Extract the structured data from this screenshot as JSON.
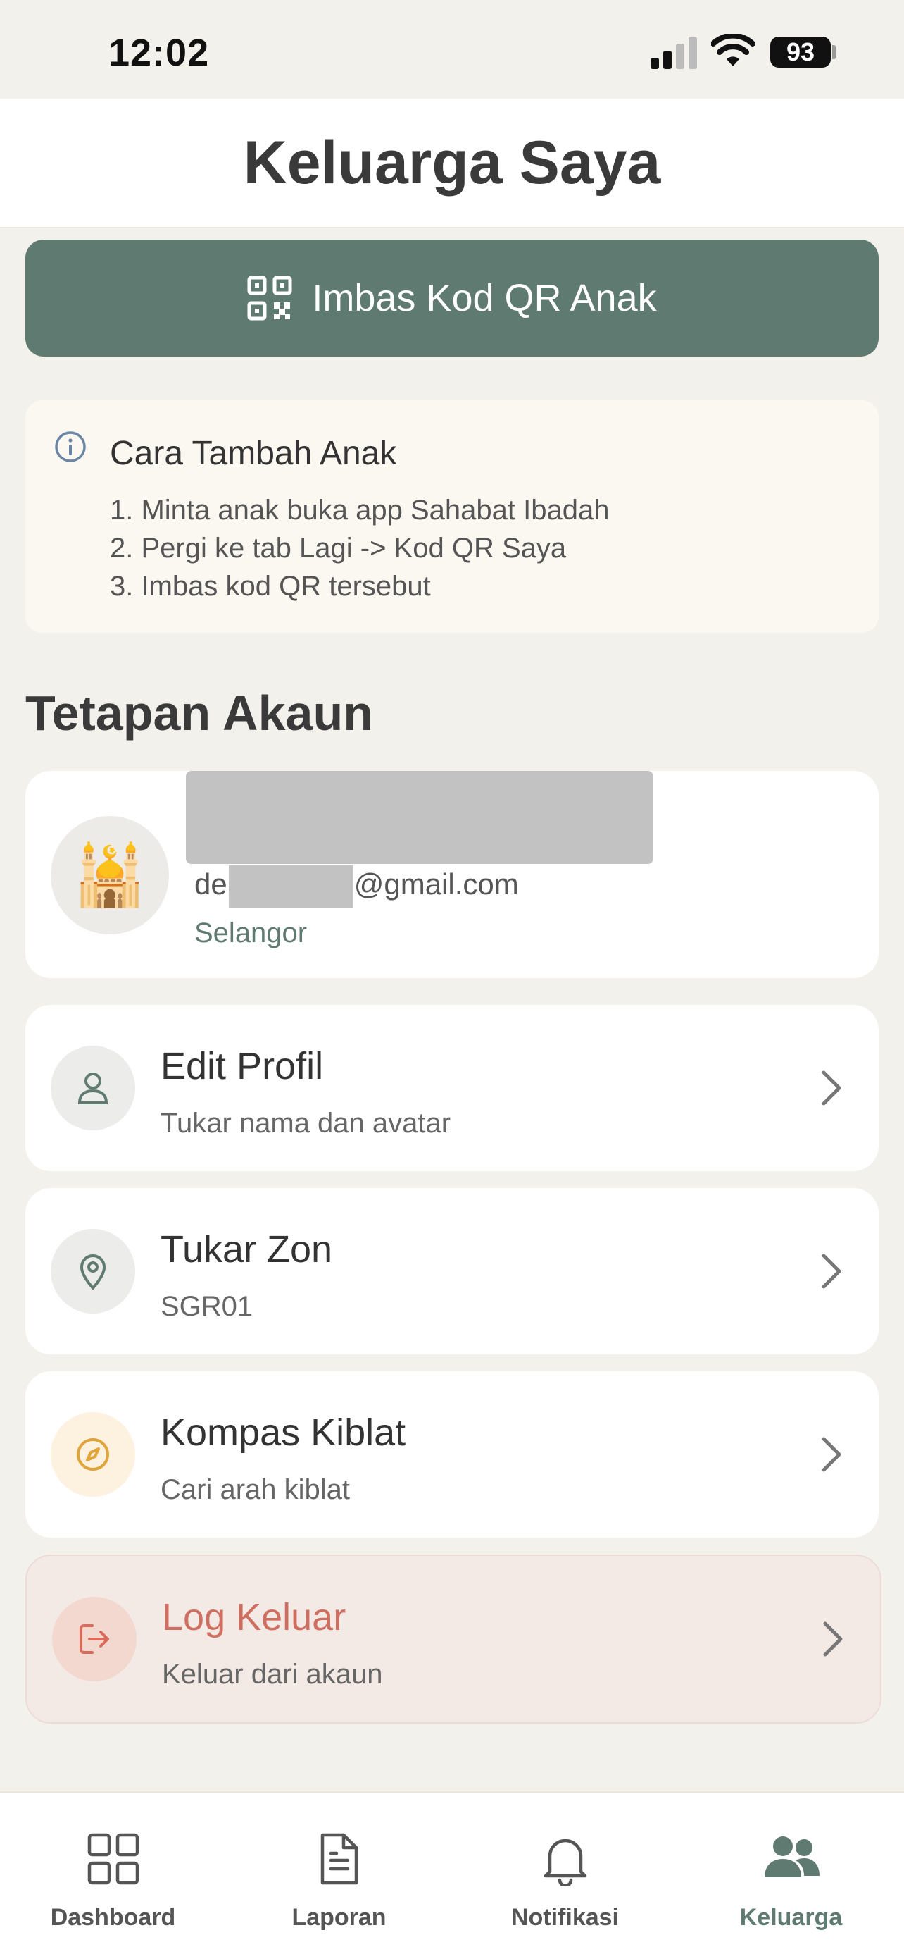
{
  "status_bar": {
    "time": "12:02",
    "battery": "93"
  },
  "header": {
    "title": "Keluarga Saya"
  },
  "scan_button": {
    "label": "Imbas Kod QR Anak",
    "icon": "qr-code-icon"
  },
  "info_card": {
    "title": "Cara Tambah Anak",
    "steps": [
      "1. Minta anak buka app Sahabat Ibadah",
      "2. Pergi ke tab Lagi -> Kod QR Saya",
      "3. Imbas kod QR tersebut"
    ]
  },
  "section": {
    "title": "Tetapan Akaun"
  },
  "profile": {
    "avatar": "🕌",
    "email_prefix": "de",
    "email_suffix": "@gmail.com",
    "location": "Selangor"
  },
  "settings": [
    {
      "title": "Edit Profil",
      "subtitle": "Tukar nama dan avatar",
      "icon": "user-icon"
    },
    {
      "title": "Tukar Zon",
      "subtitle": "SGR01",
      "icon": "location-pin-icon"
    },
    {
      "title": "Kompas Kiblat",
      "subtitle": "Cari arah kiblat",
      "icon": "compass-icon"
    },
    {
      "title": "Log Keluar",
      "subtitle": "Keluar dari akaun",
      "icon": "logout-icon"
    }
  ],
  "bottom_nav": [
    {
      "label": "Dashboard",
      "icon": "grid-icon"
    },
    {
      "label": "Laporan",
      "icon": "document-icon"
    },
    {
      "label": "Notifikasi",
      "icon": "bell-icon"
    },
    {
      "label": "Keluarga",
      "icon": "family-icon",
      "active": true
    }
  ],
  "colors": {
    "accent": "#5f7b71",
    "background": "#f3f1ec",
    "logout": "#cf6f62"
  }
}
